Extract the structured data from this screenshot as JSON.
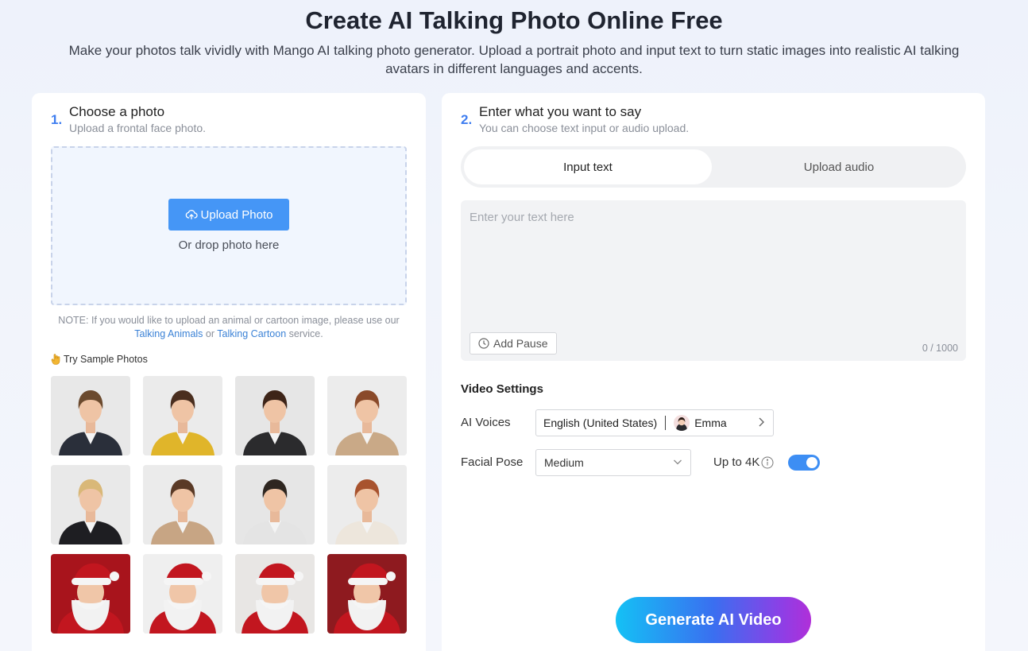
{
  "hero": {
    "title": "Create AI Talking Photo Online Free",
    "subtitle_line1": "Make your photos talk vividly with Mango AI talking photo generator. Upload a portrait photo and input text to turn static images into realistic AI talking",
    "subtitle_line2": "avatars in different languages and accents."
  },
  "step1": {
    "number": "1.",
    "title": "Choose a photo",
    "subtitle": "Upload a frontal face photo.",
    "upload_label": "Upload Photo",
    "drop_text": "Or drop photo here",
    "note_prefix": "NOTE: If you would like to upload an animal or cartoon image, please use our",
    "note_link1": "Talking Animals",
    "note_or": "or",
    "note_link2": "Talking Cartoon",
    "note_suffix": "service.",
    "try_label": "Try Sample Photos"
  },
  "samples": [
    {
      "icon": "man-suit-portrait",
      "bg": "#e8e8e8",
      "hair": "#6b4a2e",
      "outfit": "#2a2f3a"
    },
    {
      "icon": "woman-yellow-blazer-portrait",
      "bg": "#ebebeb",
      "hair": "#4a2e1f",
      "outfit": "#e0b52a"
    },
    {
      "icon": "woman-dark-blazer-portrait",
      "bg": "#e6e6e6",
      "hair": "#3d2418",
      "outfit": "#2b2b2d"
    },
    {
      "icon": "woman-beige-blazer-portrait",
      "bg": "#ececec",
      "hair": "#8a4a2a",
      "outfit": "#c9a987"
    },
    {
      "icon": "woman-glasses-tie-portrait",
      "bg": "#e9e9e9",
      "hair": "#d9b878",
      "outfit": "#1e1e22"
    },
    {
      "icon": "woman-glasses-beige-portrait",
      "bg": "#ebebeb",
      "hair": "#5a3a26",
      "outfit": "#c7a584"
    },
    {
      "icon": "man-white-suit-portrait",
      "bg": "#e6e6e6",
      "hair": "#2e2620",
      "outfit": "#e4e4e4"
    },
    {
      "icon": "woman-redhead-portrait",
      "bg": "#ececec",
      "hair": "#a8532e",
      "outfit": "#ede6dc"
    },
    {
      "icon": "santa-portrait-1",
      "bg": "#a8141c",
      "hair": "#f2f2f2",
      "outfit": "#c2161f"
    },
    {
      "icon": "santa-portrait-2",
      "bg": "#efefef",
      "hair": "#f2f2f2",
      "outfit": "#c2161f"
    },
    {
      "icon": "santa-portrait-3",
      "bg": "#e8e6e4",
      "hair": "#f2f2f2",
      "outfit": "#c2161f"
    },
    {
      "icon": "santa-portrait-4",
      "bg": "#8e1a1f",
      "hair": "#f2f2f2",
      "outfit": "#c2161f"
    }
  ],
  "step2": {
    "number": "2.",
    "title": "Enter what you want to say",
    "subtitle": "You can choose text input or audio upload.",
    "tab_text": "Input text",
    "tab_audio": "Upload audio",
    "text_placeholder": "Enter your text here",
    "add_pause": "Add Pause",
    "counter": "0 / 1000"
  },
  "settings": {
    "title": "Video Settings",
    "voices_label": "AI Voices",
    "voice_language": "English (United States)",
    "voice_name": "Emma",
    "pose_label": "Facial Pose",
    "pose_value": "Medium",
    "up4k_label": "Up to 4K",
    "up4k_enabled": true
  },
  "generate_label": "Generate AI Video",
  "colors": {
    "accent": "#4596f6",
    "step_number": "#3f7ef0",
    "link": "#3b82d6"
  }
}
